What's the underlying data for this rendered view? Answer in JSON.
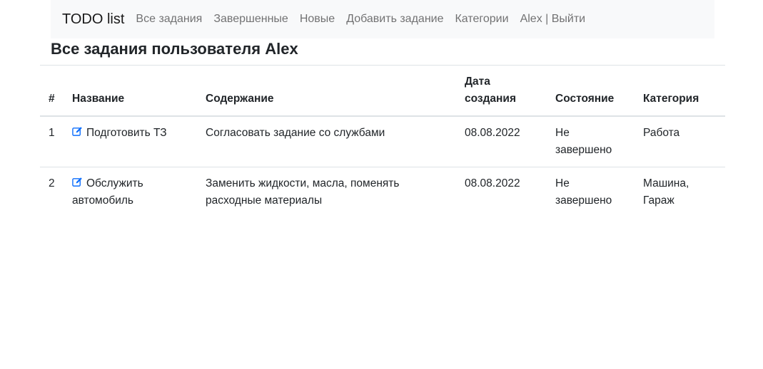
{
  "navbar": {
    "brand": "TODO list",
    "links": [
      {
        "label": "Все задания"
      },
      {
        "label": "Завершенные"
      },
      {
        "label": "Новые"
      },
      {
        "label": "Добавить задание"
      },
      {
        "label": "Категории"
      },
      {
        "label": "Alex | Выйти"
      }
    ]
  },
  "page": {
    "title": "Все задания пользователя Alex"
  },
  "table": {
    "columns": [
      "#",
      "Название",
      "Содержание",
      "Дата создания",
      "Состояние",
      "Категория"
    ],
    "rows": [
      {
        "num": "1",
        "name": "Подготовить ТЗ",
        "content": "Согласовать задание со службами",
        "created": "08.08.2022",
        "status": "Не завершено",
        "category": "Работа",
        "icon": "edit-icon"
      },
      {
        "num": "2",
        "name": "Обслужить автомобиль",
        "content": "Заменить жидкости, масла, поменять расходные материалы",
        "created": "08.08.2022",
        "status": "Не завершено",
        "category": "Машина, Гараж",
        "icon": "edit-icon"
      }
    ]
  },
  "colors": {
    "navbar_bg": "#f8f9fa",
    "icon_blue": "#0d6efd",
    "border": "#dee2e6"
  }
}
